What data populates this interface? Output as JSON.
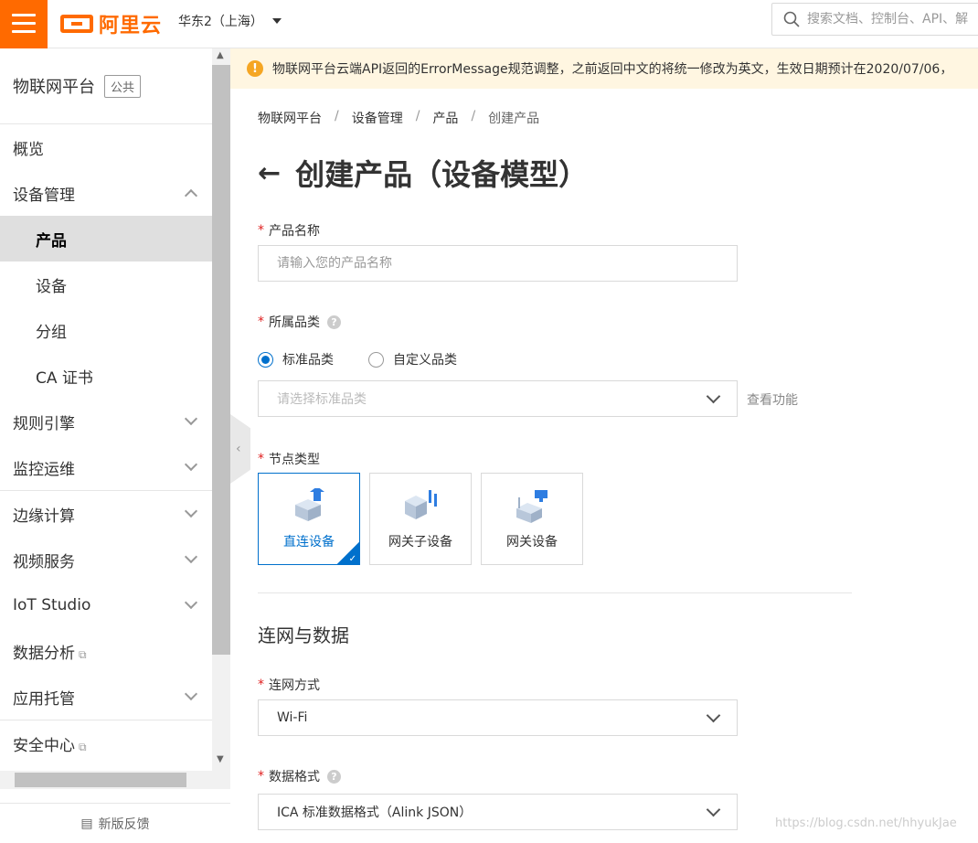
{
  "topbar": {
    "logo_text": "阿里云",
    "region": "华东2（上海）",
    "search_placeholder": "搜索文档、控制台、API、解"
  },
  "sidebar": {
    "title": "物联网平台",
    "badge": "公共",
    "items": [
      {
        "label": "概览"
      },
      {
        "label": "设备管理"
      },
      {
        "label": "产品"
      },
      {
        "label": "设备"
      },
      {
        "label": "分组"
      },
      {
        "label": "CA 证书"
      },
      {
        "label": "规则引擎"
      },
      {
        "label": "监控运维"
      },
      {
        "label": "边缘计算"
      },
      {
        "label": "视频服务"
      },
      {
        "label": "IoT Studio"
      },
      {
        "label": "数据分析"
      },
      {
        "label": "应用托管"
      },
      {
        "label": "安全中心"
      }
    ],
    "footer": "新版反馈"
  },
  "notice": {
    "text": "物联网平台云端API返回的ErrorMessage规范调整，之前返回中文的将统一修改为英文，生效日期预计在2020/07/06，"
  },
  "breadcrumb": [
    "物联网平台",
    "设备管理",
    "产品",
    "创建产品"
  ],
  "page": {
    "title": "创建产品（设备模型）"
  },
  "form": {
    "product_name": {
      "label": "产品名称",
      "placeholder": "请输入您的产品名称"
    },
    "category": {
      "label": "所属品类",
      "options": [
        "标准品类",
        "自定义品类"
      ],
      "selected": "标准品类",
      "placeholder": "请选择标准品类",
      "view_link": "查看功能"
    },
    "node_type": {
      "label": "节点类型",
      "options": [
        "直连设备",
        "网关子设备",
        "网关设备"
      ],
      "selected": "直连设备"
    },
    "section_title": "连网与数据",
    "network": {
      "label": "连网方式",
      "value": "Wi-Fi"
    },
    "data_format": {
      "label": "数据格式",
      "value": "ICA 标准数据格式（Alink JSON）"
    }
  },
  "watermark": "https://blog.csdn.net/hhyukJae",
  "colors": {
    "brand": "#ff6a00",
    "accent": "#0070cc",
    "notice_bg": "#fff6e1"
  }
}
